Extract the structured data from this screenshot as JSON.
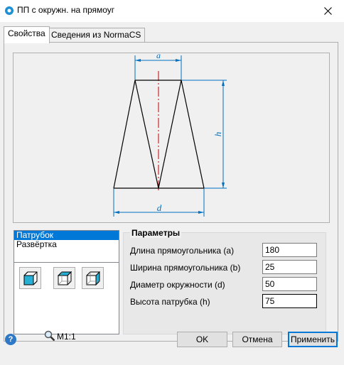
{
  "window": {
    "title": "ПП с окружн. на прямоуг"
  },
  "tabs": [
    {
      "label": "Свойства",
      "active": true
    },
    {
      "label": "Сведения из NormaCS",
      "active": false
    }
  ],
  "drawing": {
    "dim_top": "a",
    "dim_right": "h",
    "dim_bottom": "d",
    "line_color": "#000000",
    "dimension_color": "#0070c0",
    "axis_color": "#c00000"
  },
  "list": {
    "items": [
      {
        "label": "Патрубок",
        "selected": true
      },
      {
        "label": "Развёртка",
        "selected": false
      }
    ]
  },
  "view_buttons": [
    {
      "icon": "cube-front-view-icon"
    },
    {
      "icon": "cube-top-view-icon"
    },
    {
      "icon": "cube-side-view-icon"
    }
  ],
  "parameters": {
    "title": "Параметры",
    "fields": [
      {
        "label": "Длина прямоугольника (a)",
        "value": "180"
      },
      {
        "label": "Ширина прямоугольника (b)",
        "value": "25"
      },
      {
        "label": "Диаметр окружности (d)",
        "value": "50"
      },
      {
        "label": "Высота патрубка (h)",
        "value": "75"
      }
    ]
  },
  "footer": {
    "scale": "M1:1",
    "ok_label": "OK",
    "cancel_label": "Отмена",
    "apply_label": "Применить"
  },
  "colors": {
    "accent": "#0078d7",
    "help": "#2e78c6"
  }
}
